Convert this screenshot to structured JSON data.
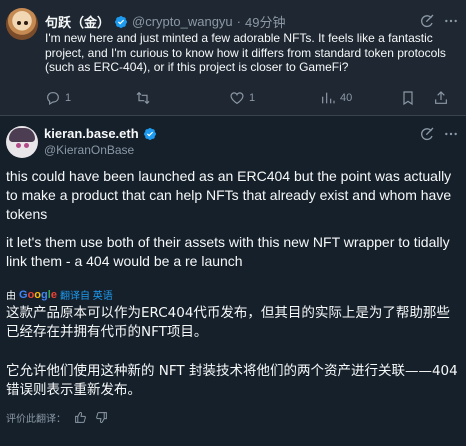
{
  "reply": {
    "author_name": "句跃（金）",
    "handle": "@crypto_wangyu",
    "separator": "·",
    "time": "49分钟",
    "text": "I'm new here and just minted a few adorable NFTs. It feels like a fantastic project, and I'm curious to know how it differs from standard token protocols (such as ERC-404), or if this project is closer to GameFi?",
    "stats": {
      "replies": "1",
      "reposts": "",
      "likes": "1",
      "views": "40"
    }
  },
  "post": {
    "author_name": "kieran.base.eth",
    "handle": "@KieranOnBase",
    "paragraph_1": "this could have been launched as an ERC404 but the point was actually to make a product that can help NFTs that already exist and whom have tokens",
    "paragraph_2": "it let's them use both of their assets with this new NFT wrapper to tidally link them - a 404 would be a re launch",
    "translated_by_prefix": "由",
    "translated_by_brand": "Google",
    "translated_from": "翻译自 英语",
    "translation_1": "这款产品原本可以作为ERC404代币发布，但其目的实际上是为了帮助那些已经存在并拥有代币的NFT项目。",
    "translation_2": "它允许他们使用这种新的 NFT 封装技术将他们的两个资产进行关联——404 错误则表示重新发布。",
    "rate_label": "评价此翻译："
  },
  "icons": {
    "verified": "verified-badge-icon",
    "grok": "grok-icon",
    "more": "more-icon",
    "reply": "reply-icon",
    "repost": "repost-icon",
    "like": "heart-icon",
    "views": "views-icon",
    "bookmark": "bookmark-icon",
    "share": "share-icon",
    "thumbs_up": "thumbs-up-icon",
    "thumbs_down": "thumbs-down-icon"
  },
  "colors": {
    "background": "#15202b",
    "reply_background": "#1e2732",
    "accent": "#1d9bf0",
    "secondary_text": "#8b98a5"
  }
}
